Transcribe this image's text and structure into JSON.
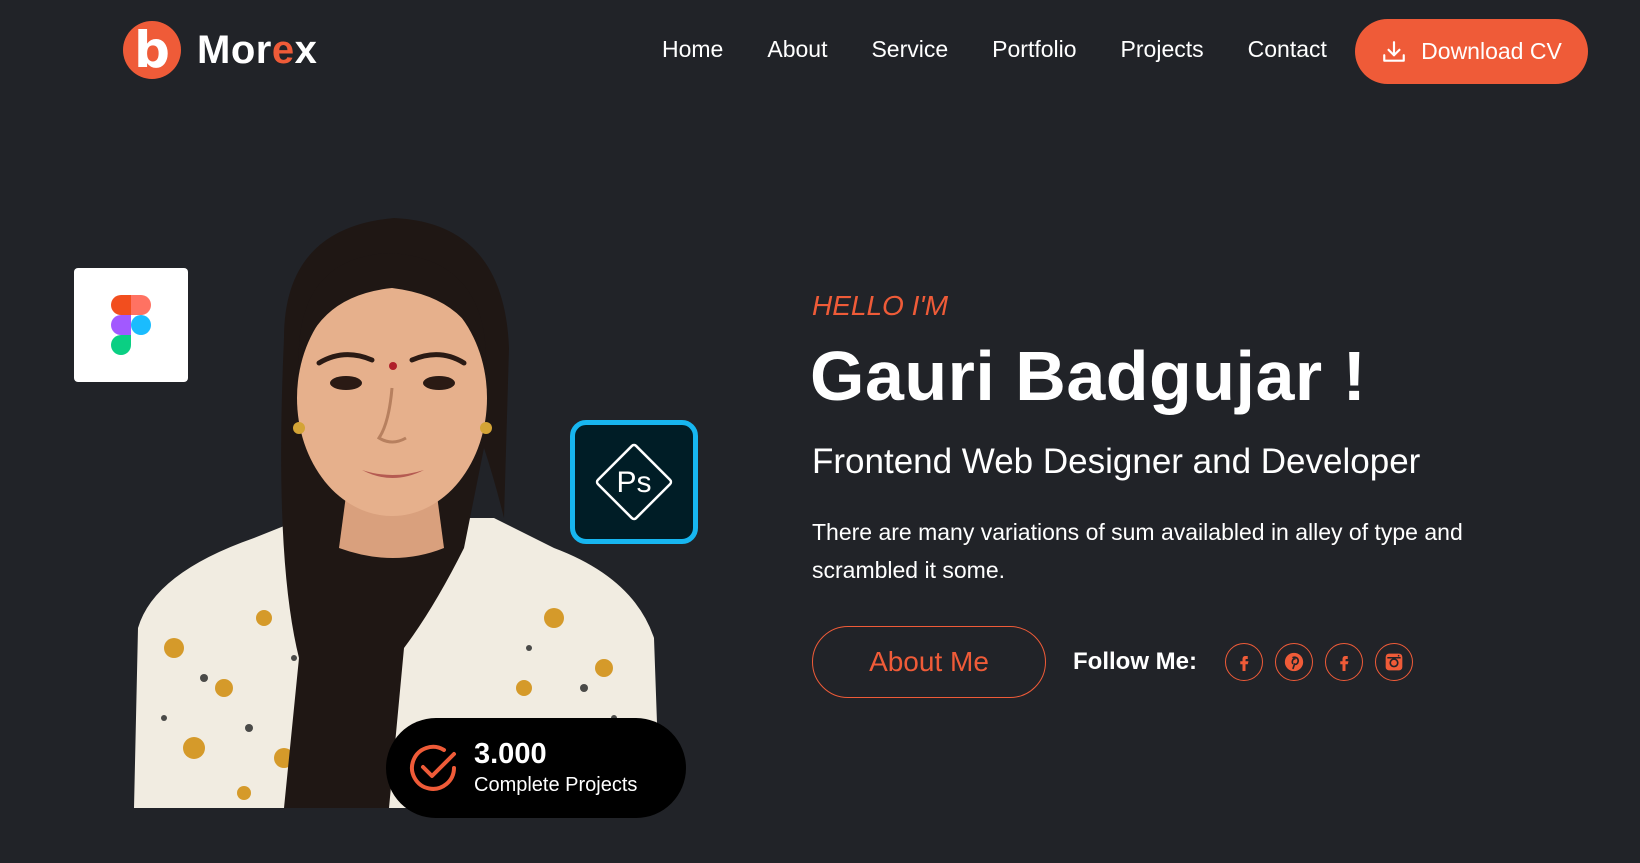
{
  "brand": {
    "logo_letter": "b",
    "name_start": "Mor",
    "name_accent": "e",
    "name_end": "x",
    "accent": "#ef5b38"
  },
  "nav": {
    "items": [
      "Home",
      "About",
      "Service",
      "Portfolio",
      "Projects",
      "Contact"
    ],
    "cta_label": "Download CV",
    "cta_icon": "download-icon"
  },
  "hero": {
    "greeting": "HELLO I'M",
    "name": "Gauri Badgujar !",
    "role": "Frontend Web Designer and Developer",
    "description": "There are many variations of sum availabled in alley of type and scrambled it some.",
    "about_button": "About Me",
    "follow_label": "Follow Me:",
    "socials": [
      "facebook-icon",
      "pinterest-icon",
      "facebook-icon",
      "instagram-icon"
    ]
  },
  "stats": {
    "value": "3.000",
    "label": "Complete Projects",
    "icon": "check-circle-icon"
  },
  "badges": [
    "figma-icon",
    "photoshop-icon"
  ],
  "colors": {
    "background": "#212328",
    "accent": "#ef5b38",
    "ps_blue": "#17b6f0"
  }
}
